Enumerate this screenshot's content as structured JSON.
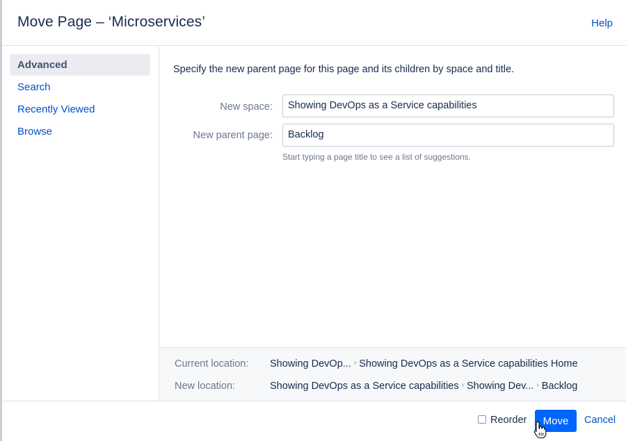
{
  "dialog": {
    "title": "Move Page – ‘Microservices’",
    "help_label": "Help"
  },
  "sidebar": {
    "items": [
      {
        "label": "Advanced",
        "selected": true
      },
      {
        "label": "Search",
        "selected": false
      },
      {
        "label": "Recently Viewed",
        "selected": false
      },
      {
        "label": "Browse",
        "selected": false
      }
    ]
  },
  "advanced": {
    "instruction": "Specify the new parent page for this page and its children by space and title.",
    "new_space_label": "New space:",
    "new_space_value": "Showing DevOps as a Service capabilities",
    "new_parent_label": "New parent page:",
    "new_parent_value": "Backlog",
    "hint": "Start typing a page title to see a list of suggestions."
  },
  "location": {
    "current_label": "Current location:",
    "current_path": [
      "Showing DevOp...",
      "Showing DevOps as a Service capabilities Home"
    ],
    "new_label": "New location:",
    "new_path": [
      "Showing DevOps as a Service capabilities",
      "Showing Dev...",
      "Backlog"
    ]
  },
  "footer": {
    "reorder_label": "Reorder",
    "reorder_checked": false,
    "move_label": "Move",
    "cancel_label": "Cancel"
  },
  "colors": {
    "primary": "#0065ff",
    "link": "#0052cc"
  },
  "icons": {
    "separator": "chevron-right-icon",
    "cursor": "hand-pointer-icon"
  }
}
